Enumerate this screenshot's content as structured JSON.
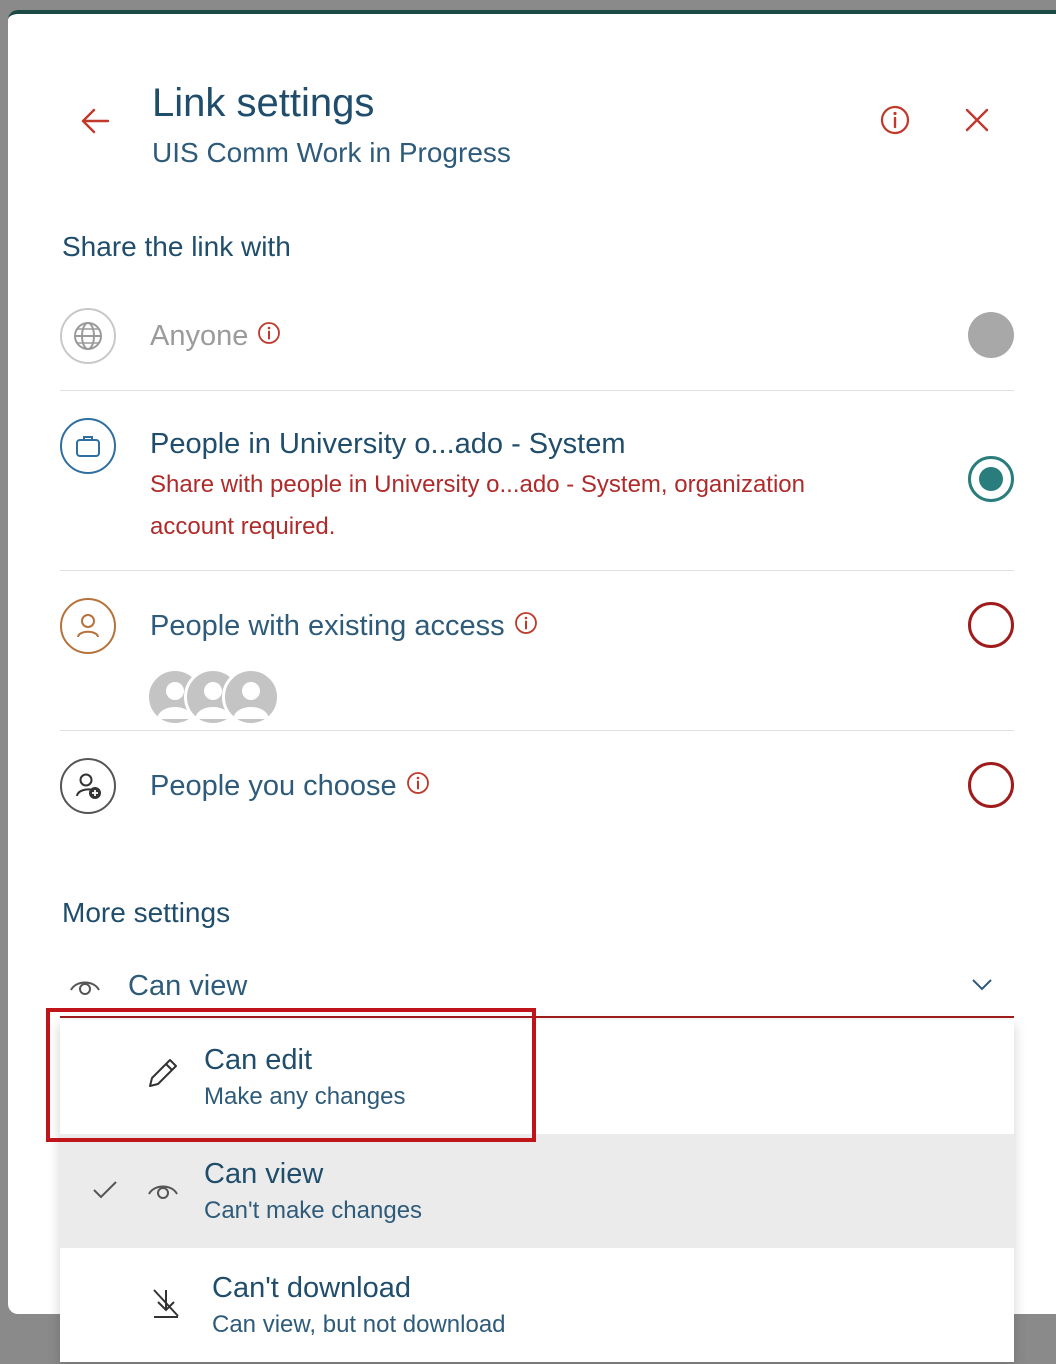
{
  "header": {
    "title": "Link settings",
    "subtitle": "UIS Comm Work in Progress"
  },
  "share_section": {
    "label": "Share the link with",
    "options": [
      {
        "title": "Anyone",
        "state": "disabled",
        "icon": "globe-icon"
      },
      {
        "title": "People in University o...ado - System",
        "description": "Share with people in University o...ado - System, organization account required.",
        "state": "selected",
        "icon": "briefcase-icon"
      },
      {
        "title": "People with existing access",
        "state": "unselected",
        "icon": "person-icon"
      },
      {
        "title": "People you choose",
        "state": "unselected",
        "icon": "person-add-icon"
      }
    ]
  },
  "more_settings": {
    "label": "More settings",
    "permission": {
      "current_label": "Can view",
      "items": [
        {
          "title": "Can edit",
          "description": "Make any changes",
          "icon": "pencil-icon"
        },
        {
          "title": "Can view",
          "description": "Can't make changes",
          "icon": "eye-icon",
          "selected": true
        },
        {
          "title": "Can't download",
          "description": "Can view, but not download",
          "icon": "no-download-icon"
        }
      ]
    }
  },
  "colors": {
    "title": "#1f4d6b",
    "accent_red": "#b02a2a",
    "radio_selected": "#2a7d7d",
    "highlight": "#c0141b"
  }
}
